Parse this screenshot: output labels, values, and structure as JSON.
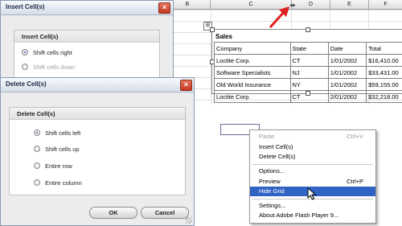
{
  "spreadsheet": {
    "columns": [
      "B",
      "C",
      "D",
      "E",
      "F"
    ],
    "table": {
      "title": "Sales",
      "rows": [
        [
          "Company",
          "State",
          "Date",
          "Total"
        ],
        [
          "Loctite Corp.",
          "CT",
          "1/01/2002",
          "$16,410.00"
        ],
        [
          "Software Specialists",
          "NJ",
          "1/01/2002",
          "$33,431.00"
        ],
        [
          "Old World Insurance",
          "NY",
          "1/01/2002",
          "$59,155.00"
        ],
        [
          "Loctite Corp.",
          "CT",
          "2/01/2002",
          "$32,218.00"
        ]
      ]
    }
  },
  "context_menu": {
    "items": [
      {
        "label": "Paste",
        "shortcut": "Ctrl+V",
        "disabled": true
      },
      {
        "label": "Insert Cell(s)",
        "shortcut": ""
      },
      {
        "label": "Delete Cell(s)",
        "shortcut": ""
      },
      {
        "label": "Options...",
        "shortcut": ""
      },
      {
        "label": "Preview",
        "shortcut": "Ctrl+P"
      },
      {
        "label": "Hide Grid",
        "shortcut": "",
        "highlighted": true
      },
      {
        "label": "Settings...",
        "shortcut": ""
      },
      {
        "label": "About Adobe Flash Player 9...",
        "shortcut": ""
      }
    ]
  },
  "insert_dialog": {
    "title": "Insert Cell(s)",
    "group_title": "Insert Cell(s)",
    "options": [
      "Shift cells right",
      "Shift cells down"
    ]
  },
  "delete_dialog": {
    "title": "Delete Cell(s)",
    "group_title": "Delete Cell(s)",
    "options": [
      "Shift cells left",
      "Shift cells up",
      "Entire row",
      "Entire column"
    ],
    "selected_option": "Shift cells left",
    "ok_label": "OK",
    "cancel_label": "Cancel"
  },
  "colors": {
    "menu_highlight": "#3163c5",
    "close_button": "#c3391f",
    "annotation_arrow": "#e02020"
  },
  "icons": [
    "resize-cursor-icon",
    "move-handle-icon",
    "close-icon",
    "mouse-pointer-icon",
    "red-arrow-icon"
  ]
}
